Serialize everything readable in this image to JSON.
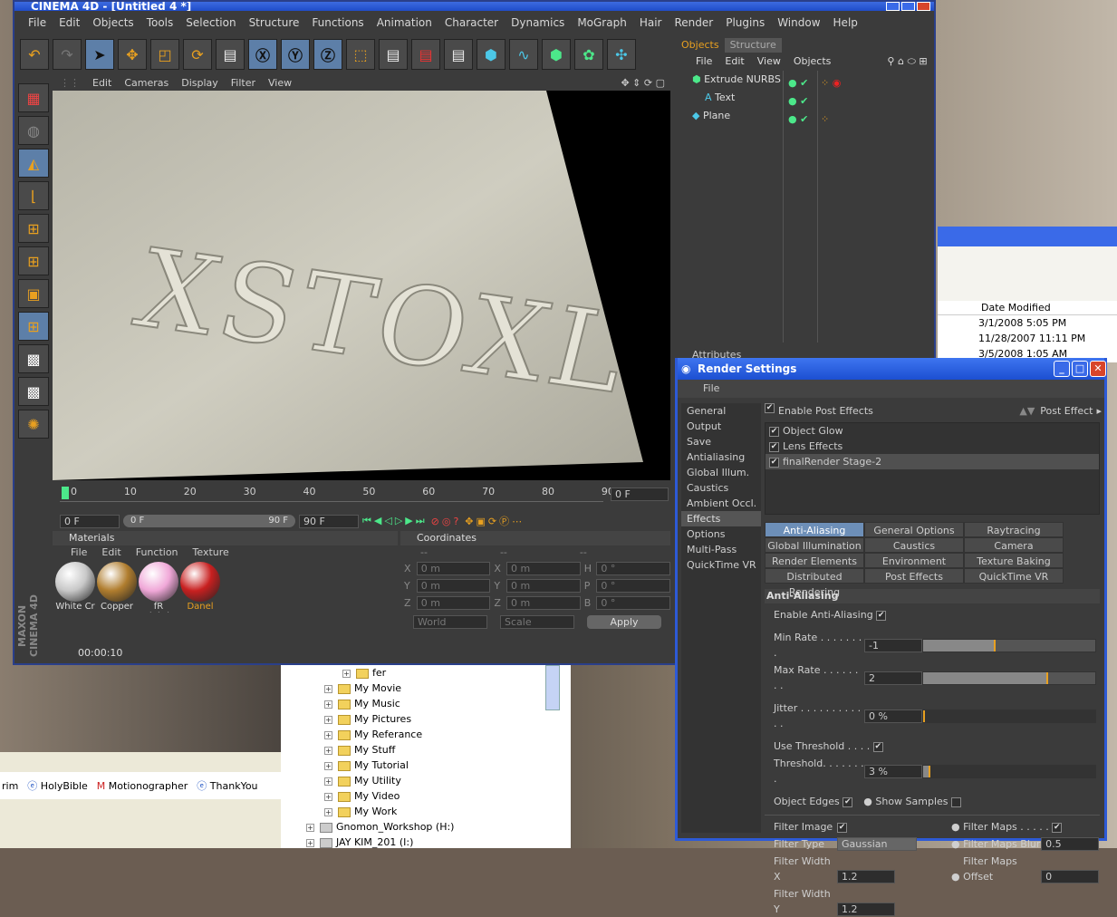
{
  "app_title": "CINEMA 4D - [Untitled 4 *]",
  "menu": [
    "File",
    "Edit",
    "Objects",
    "Tools",
    "Selection",
    "Structure",
    "Functions",
    "Animation",
    "Character",
    "Dynamics",
    "MoGraph",
    "Hair",
    "Render",
    "Plugins",
    "Window",
    "Help"
  ],
  "viewport": {
    "menu": [
      "Edit",
      "Cameras",
      "Display",
      "Filter",
      "View"
    ],
    "text3d": "XSTOXL"
  },
  "timeline": {
    "ticks": [
      "0",
      "10",
      "20",
      "30",
      "40",
      "50",
      "60",
      "70",
      "80",
      "90"
    ],
    "frame_right": "0 F",
    "start_field": "0 F",
    "range_left": "0 F",
    "range_right": "90 F",
    "end_field": "90 F"
  },
  "materials": {
    "title": "Materials",
    "menu": [
      "File",
      "Edit",
      "Function",
      "Texture"
    ],
    "items": [
      {
        "label": "White Cr",
        "color": "#c8c8c8"
      },
      {
        "label": "Copper F",
        "color": "#b07d2e"
      },
      {
        "label": "fR Lightb",
        "color": "#f0a8d8"
      },
      {
        "label": "Danel",
        "color": "#c82020"
      }
    ]
  },
  "coordinates": {
    "title": "Coordinates",
    "cols": [
      "--",
      "--",
      "--"
    ],
    "rows": [
      {
        "a": "X",
        "av": "0 m",
        "b": "X",
        "bv": "0 m",
        "c": "H",
        "cv": "0 °"
      },
      {
        "a": "Y",
        "av": "0 m",
        "b": "Y",
        "bv": "0 m",
        "c": "P",
        "cv": "0 °"
      },
      {
        "a": "Z",
        "av": "0 m",
        "b": "Z",
        "bv": "0 m",
        "c": "B",
        "cv": "0 °"
      }
    ],
    "world": "World",
    "scale": "Scale",
    "apply": "Apply"
  },
  "status": {
    "time": "00:00:10"
  },
  "side_logo": "MAXON CINEMA 4D",
  "objects_panel": {
    "tabs": [
      "Objects",
      "Structure"
    ],
    "menu": [
      "File",
      "Edit",
      "View",
      "Objects"
    ],
    "items": [
      "Extrude NURBS",
      "Text",
      "Plane"
    ]
  },
  "attributes_label": "Attributes",
  "render_settings": {
    "title": "Render Settings",
    "file_menu": "File",
    "nav": [
      "General",
      "Output",
      "Save",
      "Antialiasing",
      "Global Illum.",
      "Caustics",
      "Ambient Occl.",
      "Effects",
      "Options",
      "Multi-Pass",
      "QuickTime VR"
    ],
    "nav_selected": "Effects",
    "enable_post": "Enable Post Effects",
    "post_effect": "Post Effect",
    "effects": [
      "Object Glow",
      "Lens Effects",
      "finalRender Stage-2"
    ],
    "tabs": [
      "Anti-Aliasing",
      "General Options",
      "Raytracing",
      "Global Illumination",
      "Caustics",
      "Camera",
      "Render Elements",
      "Environment",
      "Texture Baking",
      "Distributed Rendering",
      "Post Effects",
      "QuickTime VR"
    ],
    "section": "Anti-Aliasing",
    "enable_aa": "Enable Anti-Aliasing",
    "min_rate_label": "Min Rate . . . . . . . .",
    "min_rate": "-1",
    "max_rate_label": "Max Rate . . . . . . . .",
    "max_rate": "2",
    "jitter_label": "Jitter . . . . . . . . . . . .",
    "jitter": "0 %",
    "use_threshold": "Use Threshold . . . .",
    "threshold_label": "Threshold. . . . . . . .",
    "threshold": "3 %",
    "object_edges": "Object Edges",
    "show_samples": "Show Samples",
    "filter_image": "Filter Image",
    "filter_type_label": "Filter Type",
    "filter_type": "Gaussian",
    "filter_width_x_label": "Filter Width X",
    "filter_width_x": "1.2",
    "filter_width_y_label": "Filter Width Y",
    "filter_width_y": "1.2",
    "filter_maps": "Filter Maps . . . . .",
    "filter_maps_blur_label": "Filter Maps Blur",
    "filter_maps_blur": "0.5",
    "filter_maps_offset_label": "Filter Maps Offset",
    "filter_maps_offset": "0"
  },
  "file_explorer": {
    "items": [
      "fer",
      "My Movie",
      "My Music",
      "My Pictures",
      "My Referance",
      "My Stuff",
      "My Tutorial",
      "My Utility",
      "My Video",
      "My Work",
      "Gnomon_Workshop (H:)",
      "JAY KIM_201 (I:)"
    ]
  },
  "right_window": {
    "header": "Date Modified",
    "dates": [
      "3/1/2008 5:05 PM",
      "11/28/2007 11:11 PM",
      "3/5/2008 1:05 AM"
    ]
  },
  "taskbar_links": [
    "rim",
    "HolyBible",
    "Motionographer",
    "ThankYou"
  ]
}
